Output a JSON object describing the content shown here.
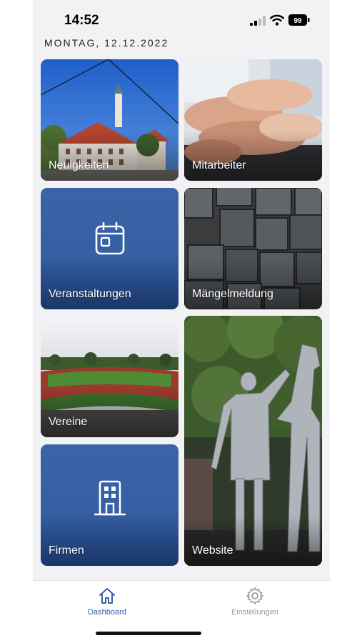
{
  "status_bar": {
    "time": "14:52",
    "battery": "99"
  },
  "date": "MONTAG, 12.12.2022",
  "tiles": [
    {
      "label": "Neuigkeiten"
    },
    {
      "label": "Mitarbeiter"
    },
    {
      "label": "Veranstaltungen",
      "icon": "calendar-icon"
    },
    {
      "label": "Mängelmeldung"
    },
    {
      "label": "Vereine"
    },
    {
      "label": "Website"
    },
    {
      "label": "Firmen",
      "icon": "building-icon"
    }
  ],
  "tabbar": [
    {
      "label": "Dashboard",
      "icon": "home-icon",
      "active": true,
      "color": "#3660a4"
    },
    {
      "label": "Einstellungen",
      "icon": "gear-icon",
      "active": false,
      "color": "#9a9aa0"
    }
  ],
  "colors": {
    "accent": "#3660a4",
    "background": "#f2f2f4"
  }
}
